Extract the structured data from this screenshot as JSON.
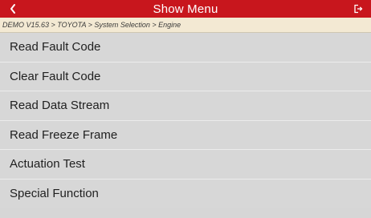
{
  "header": {
    "title": "Show Menu",
    "back_icon": "chevron-left-icon",
    "exit_icon": "exit-icon"
  },
  "breadcrumb": "DEMO V15.63 > TOYOTA > System Selection > Engine",
  "menu": {
    "items": [
      {
        "label": "Read Fault Code"
      },
      {
        "label": "Clear Fault Code"
      },
      {
        "label": "Read Data Stream"
      },
      {
        "label": "Read Freeze Frame"
      },
      {
        "label": "Actuation Test"
      },
      {
        "label": "Special Function"
      }
    ]
  },
  "colors": {
    "header_bg": "#c8161d",
    "breadcrumb_bg": "#f3e9d3",
    "menu_bg": "#d7d7d7"
  }
}
